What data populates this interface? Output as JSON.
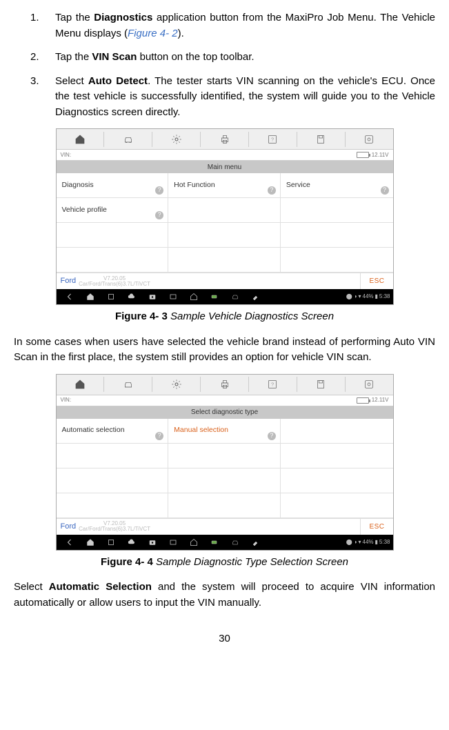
{
  "steps": [
    {
      "num": "1.",
      "prefix": "Tap the ",
      "bold": "Diagnostics",
      "mid": " application button from the MaxiPro Job Menu. The Vehicle Menu displays (",
      "link": "Figure 4- 2",
      "suffix": ")."
    },
    {
      "num": "2.",
      "prefix": "Tap the ",
      "bold": "VIN Scan",
      "suffix": " button on the top toolbar."
    },
    {
      "num": "3.",
      "prefix": "Select ",
      "bold": "Auto Detect",
      "suffix": ". The tester starts VIN scanning on the vehicle's ECU. Once the test vehicle is successfully identified, the system will guide you to the Vehicle Diagnostics screen directly."
    }
  ],
  "figure1": {
    "toolbar_header": "Main menu",
    "vin_label": "VIN:",
    "voltage": "12.11V",
    "cells": {
      "diagnosis": "Diagnosis",
      "hot": "Hot Function",
      "service": "Service",
      "profile": "Vehicle profile"
    },
    "car_brand": "Ford",
    "car_ver": "V7.20.05",
    "car_desc": "Car/Ford/Trans(6)3.7L/TiVCT",
    "esc": "ESC",
    "time": "5:38",
    "battery": "44%",
    "caption_label": "Figure 4- 3",
    "caption_title": " Sample Vehicle Diagnostics Screen"
  },
  "paragraph1": "In some cases when users have selected the vehicle brand instead of performing Auto VIN Scan in the first place, the system still provides an option for vehicle VIN scan.",
  "figure2": {
    "toolbar_header": "Select diagnostic type",
    "vin_label": "VIN:",
    "voltage": "12.11V",
    "cells": {
      "auto": "Automatic selection",
      "manual": "Manual selection"
    },
    "car_brand": "Ford",
    "car_ver": "V7.20.05",
    "car_desc": "Car/Ford/Trans(6)3.7L/TiVCT",
    "esc": "ESC",
    "time": "5:38",
    "battery": "44%",
    "caption_label": "Figure 4- 4",
    "caption_title": " Sample Diagnostic Type Selection Screen"
  },
  "paragraph2_pre": "Select ",
  "paragraph2_bold": "Automatic Selection",
  "paragraph2_post": " and the system will proceed to acquire VIN information automatically or allow users to input the VIN manually.",
  "page_number": "30",
  "q": "?"
}
